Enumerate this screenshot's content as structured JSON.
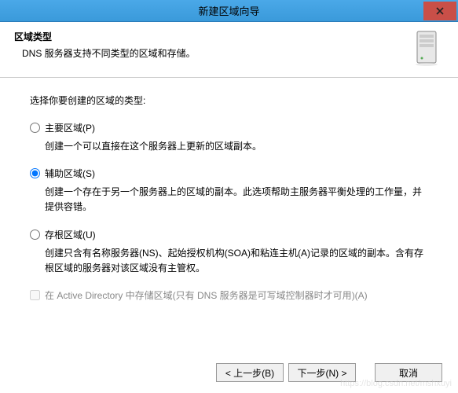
{
  "titlebar": {
    "title": "新建区域向导"
  },
  "header": {
    "title": "区域类型",
    "subtitle": "DNS 服务器支持不同类型的区域和存储。"
  },
  "content": {
    "prompt": "选择你要创建的区域的类型:",
    "options": [
      {
        "label": "主要区域(P)",
        "description": "创建一个可以直接在这个服务器上更新的区域副本。",
        "selected": false
      },
      {
        "label": "辅助区域(S)",
        "description": "创建一个存在于另一个服务器上的区域的副本。此选项帮助主服务器平衡处理的工作量，并提供容错。",
        "selected": true
      },
      {
        "label": "存根区域(U)",
        "description": "创建只含有名称服务器(NS)、起始授权机构(SOA)和粘连主机(A)记录的区域的副本。含有存根区域的服务器对该区域没有主管权。",
        "selected": false
      }
    ],
    "checkbox": {
      "label": "在 Active Directory 中存储区域(只有 DNS 服务器是可写域控制器时才可用)(A)",
      "checked": false,
      "enabled": false
    }
  },
  "buttons": {
    "back": "< 上一步(B)",
    "next": "下一步(N) >",
    "cancel": "取消"
  },
  "watermark": "https://blog.csdn.net/mshxuyi"
}
